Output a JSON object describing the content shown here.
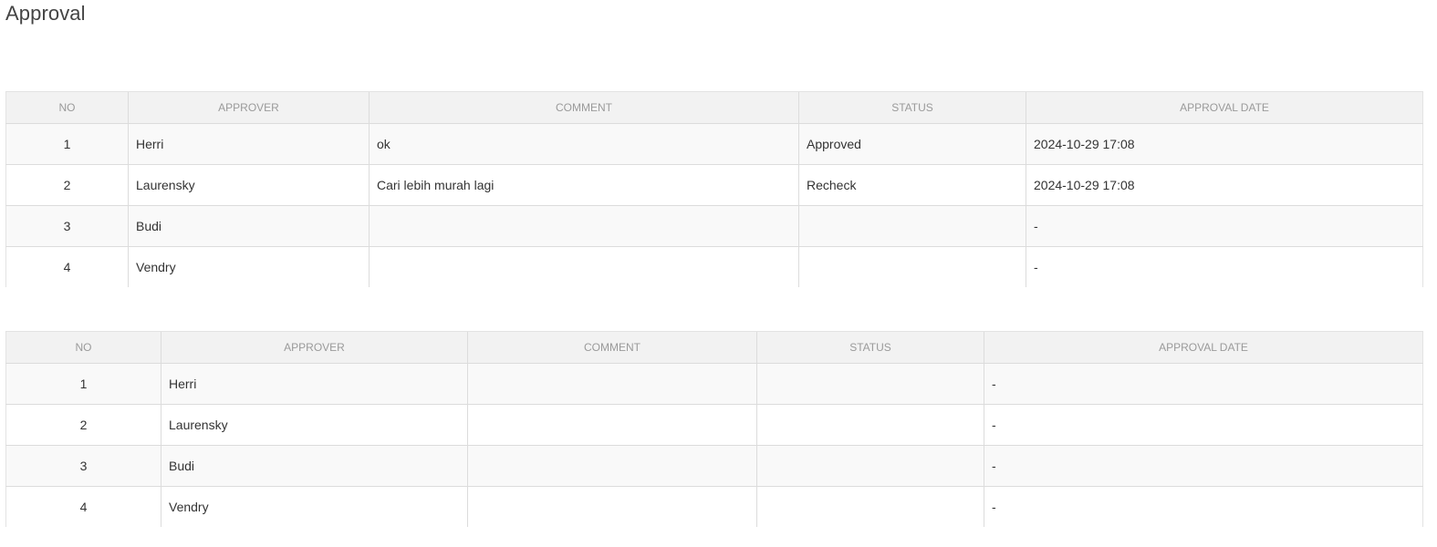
{
  "page": {
    "title": "Approval"
  },
  "tables": [
    {
      "headers": [
        "NO",
        "APPROVER",
        "COMMENT",
        "STATUS",
        "APPROVAL DATE"
      ],
      "rows": [
        {
          "no": "1",
          "approver": "Herri",
          "comment": "ok",
          "status": "Approved",
          "date": "2024-10-29 17:08"
        },
        {
          "no": "2",
          "approver": "Laurensky",
          "comment": "Cari lebih murah lagi",
          "status": "Recheck",
          "date": "2024-10-29 17:08"
        },
        {
          "no": "3",
          "approver": "Budi",
          "comment": "",
          "status": "",
          "date": "-"
        },
        {
          "no": "4",
          "approver": "Vendry",
          "comment": "",
          "status": "",
          "date": "-"
        }
      ]
    },
    {
      "headers": [
        "NO",
        "APPROVER",
        "COMMENT",
        "STATUS",
        "APPROVAL DATE"
      ],
      "rows": [
        {
          "no": "1",
          "approver": "Herri",
          "comment": "",
          "status": "",
          "date": "-"
        },
        {
          "no": "2",
          "approver": "Laurensky",
          "comment": "",
          "status": "",
          "date": "-"
        },
        {
          "no": "3",
          "approver": "Budi",
          "comment": "",
          "status": "",
          "date": "-"
        },
        {
          "no": "4",
          "approver": "Vendry",
          "comment": "",
          "status": "",
          "date": "-"
        }
      ]
    }
  ],
  "colors": {
    "header_bg": "#f2f2f2",
    "header_text": "#9a9a9a",
    "row_odd_bg": "#f9f9f9",
    "row_even_bg": "#ffffff",
    "border": "#dcdcdc",
    "text": "#333333"
  }
}
